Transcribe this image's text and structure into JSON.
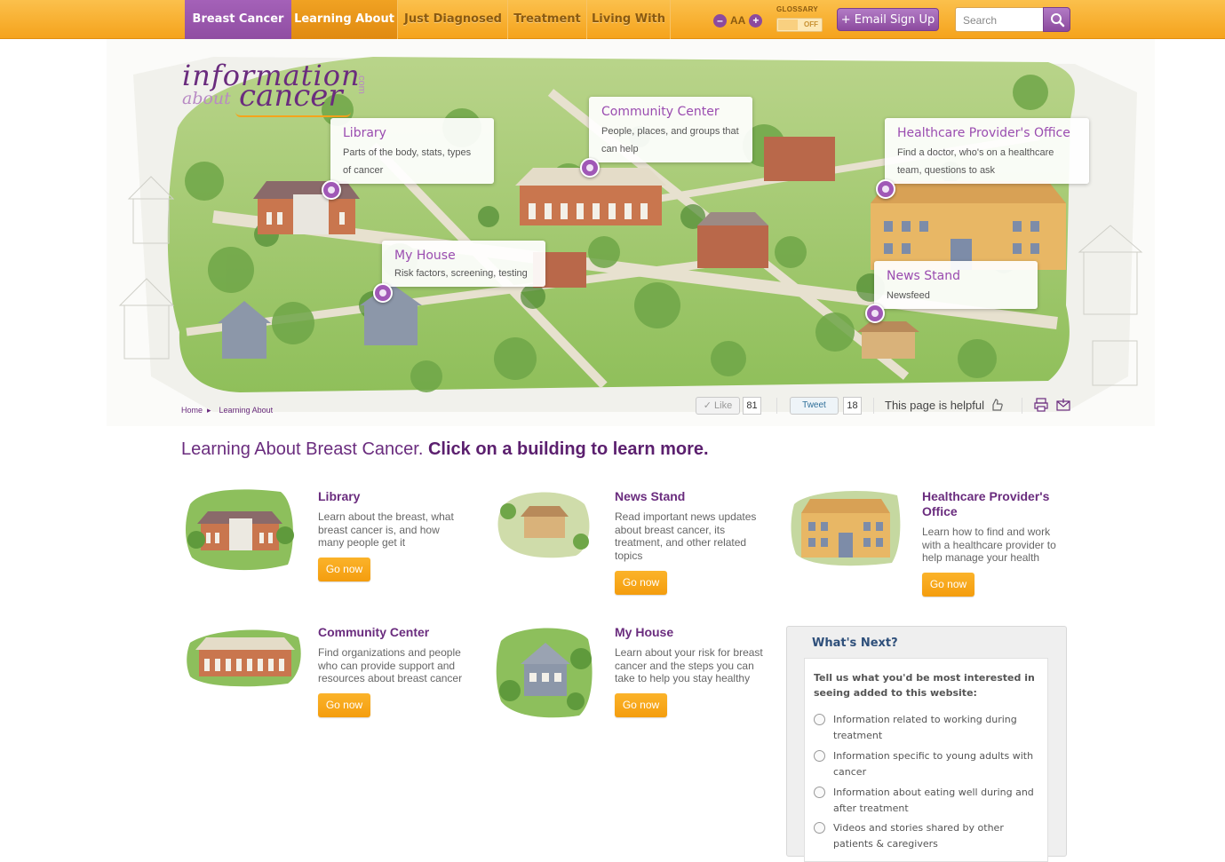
{
  "nav": {
    "tabs": [
      {
        "label": "Breast Cancer"
      },
      {
        "label": "Learning About"
      },
      {
        "label": "Just Diagnosed"
      },
      {
        "label": "Treatment"
      },
      {
        "label": "Living With"
      }
    ],
    "font_size_label": "AA",
    "font_minus": "–",
    "font_plus": "+",
    "glossary_label": "GLOSSARY",
    "glossary_state": "OFF",
    "email_signup": "+ Email Sign Up",
    "search_placeholder": "Search"
  },
  "logo": {
    "line1": "information",
    "about": "about",
    "cancer": "cancer",
    "dotcom": ".com"
  },
  "map": {
    "callouts": [
      {
        "title": "Library",
        "desc": "Parts of the body, stats, types of cancer"
      },
      {
        "title": "Community Center",
        "desc": "People, places, and groups that can help"
      },
      {
        "title": "Healthcare Provider's Office",
        "desc": "Find a doctor, who's on a healthcare team, questions to ask"
      },
      {
        "title": "My House",
        "desc": "Risk factors, screening, testing"
      },
      {
        "title": "News Stand",
        "desc": "Newsfeed"
      }
    ]
  },
  "breadcrumb": {
    "home": "Home",
    "sep": "▸",
    "current": "Learning About"
  },
  "social": {
    "like_label": "✓ Like",
    "like_count": "81",
    "tweet_label": "Tweet",
    "tweet_count": "18",
    "helpful_label": "This page is helpful"
  },
  "headline": {
    "part1": "Learning About Breast Cancer. ",
    "part2": "Click on a building to learn more."
  },
  "cards": [
    {
      "title": "Library",
      "desc": "Learn about the breast, what breast cancer is, and how many people get it",
      "button": "Go now"
    },
    {
      "title": "News Stand",
      "desc": "Read important news updates about breast cancer, its treatment, and other related topics",
      "button": "Go now"
    },
    {
      "title": "Healthcare Provider's Office",
      "desc": "Learn how to find and work with a healthcare provider to help manage your health",
      "button": "Go now"
    },
    {
      "title": "Community Center",
      "desc": "Find organizations and people who can provide support and resources about breast cancer",
      "button": "Go now"
    },
    {
      "title": "My House",
      "desc": "Learn about your risk for breast cancer and the steps you can take to help you stay healthy",
      "button": "Go now"
    }
  ],
  "whats_next": {
    "title": "What's Next?",
    "prompt": "Tell us what you'd be most interested in seeing added to this website:",
    "options": [
      "Information related to working during treatment",
      "Information specific to young adults with cancer",
      "Information about eating well during and after treatment",
      "Videos and stories shared by other patients & caregivers"
    ]
  },
  "colors": {
    "nav_orange": "#f5a31c",
    "brand_purple": "#8c4a9e",
    "heading_purple": "#6a2c7e",
    "button_orange": "#f49d0e",
    "whats_next_blue": "#2e4f7a"
  }
}
